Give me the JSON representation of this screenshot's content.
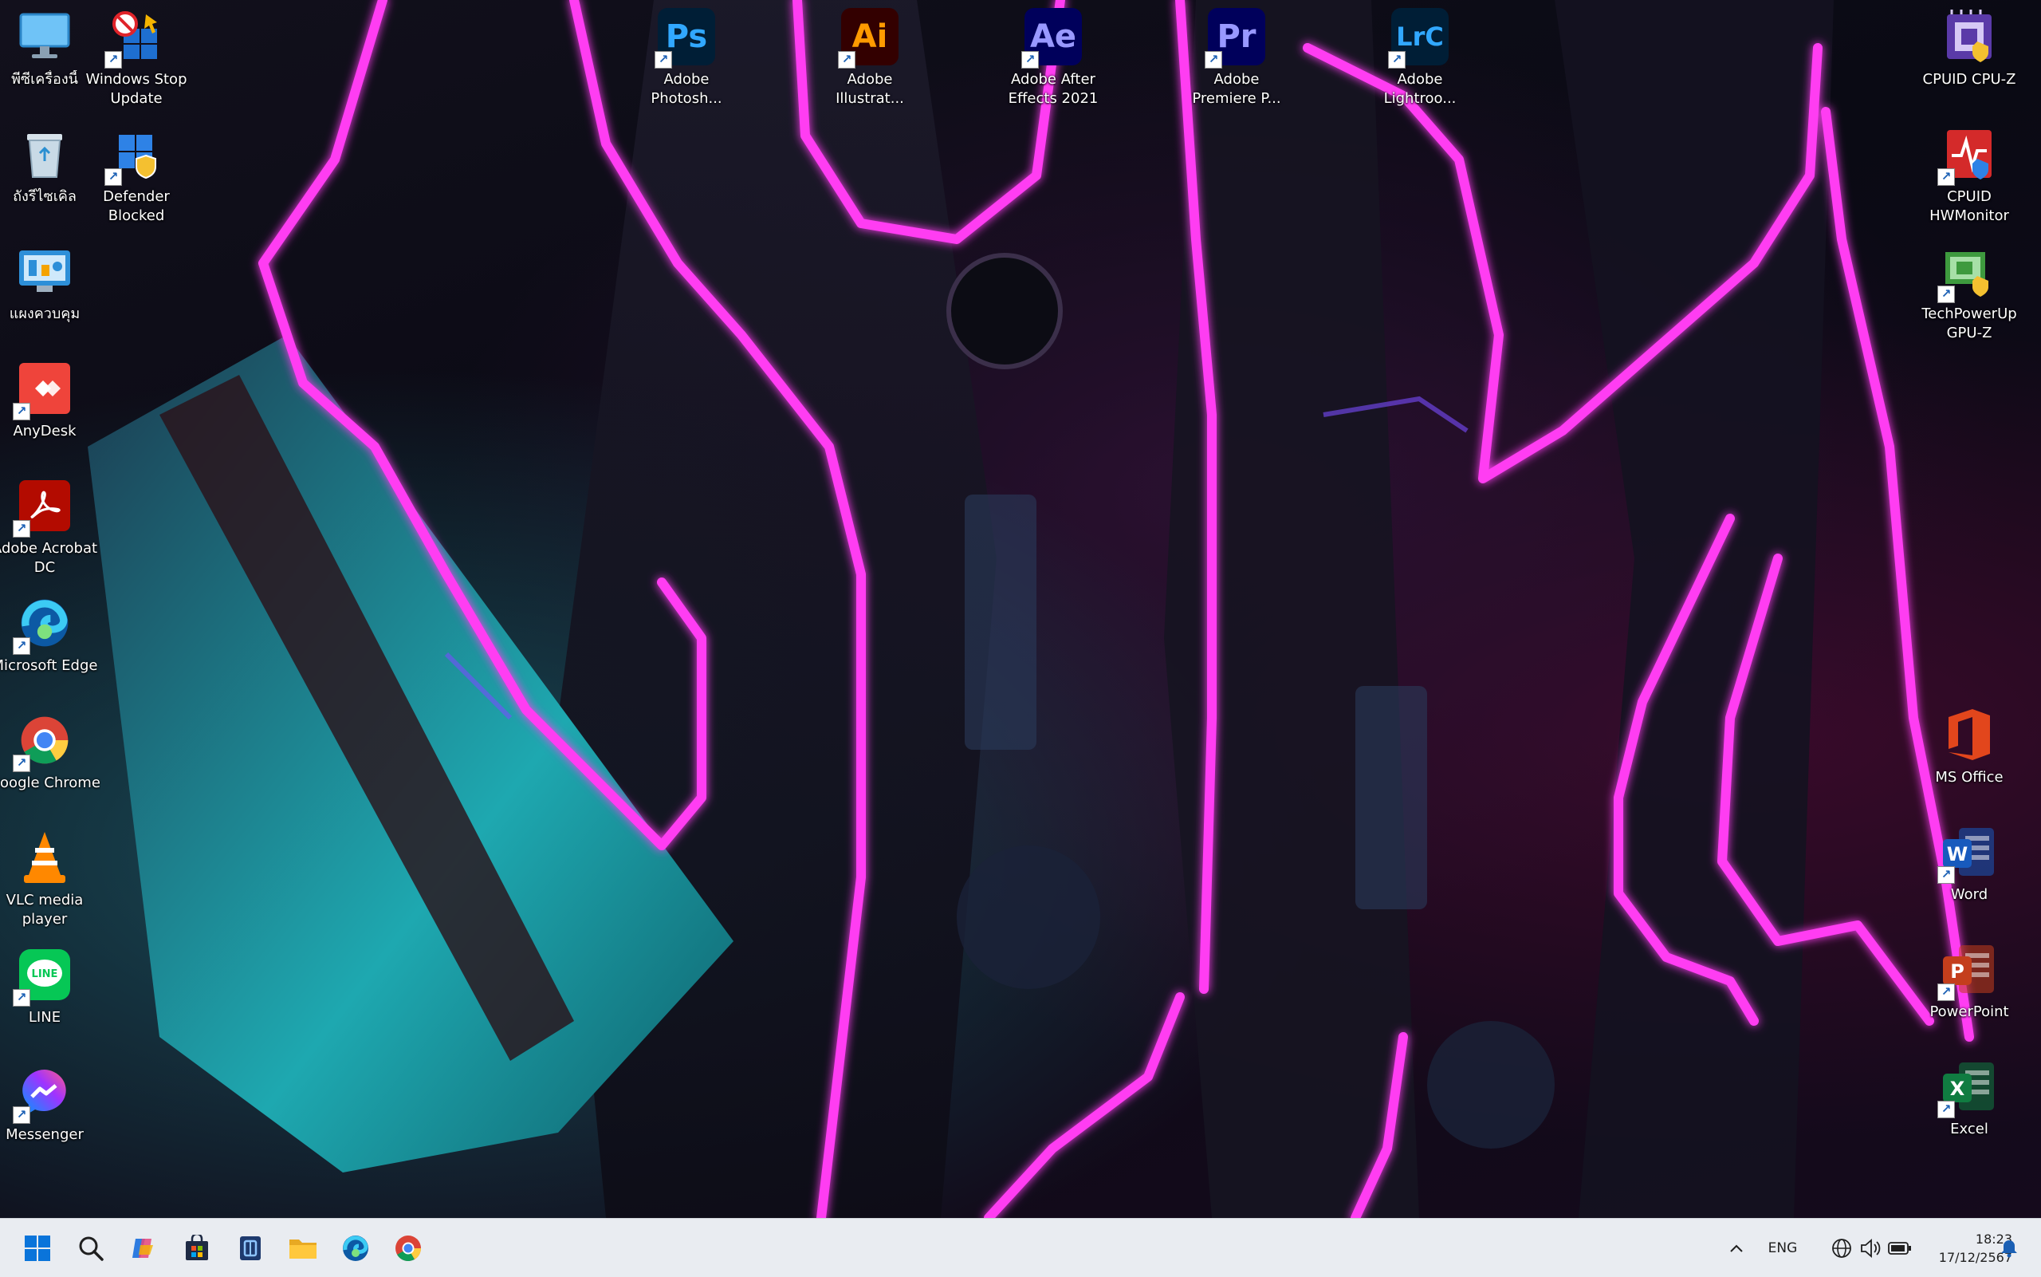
{
  "desktop": {
    "left_icons": [
      {
        "label": "พีซีเครื่องนี้",
        "icon": "monitor-icon",
        "color": "#3fa9f5",
        "shortcut": false
      },
      {
        "label": "ถังรีไซเคิล",
        "icon": "recycle-bin-icon",
        "color": "#9fb7c8",
        "shortcut": false
      },
      {
        "label": "แผงควบคุม",
        "icon": "control-panel-icon",
        "color": "#2d8fd8",
        "shortcut": false
      },
      {
        "label": "AnyDesk",
        "icon": "anydesk-icon",
        "color": "#ef443b",
        "shortcut": true
      },
      {
        "label": "Adobe Acrobat DC",
        "icon": "acrobat-icon",
        "color": "#b30b00",
        "shortcut": true
      },
      {
        "label": "Microsoft Edge",
        "icon": "edge-icon",
        "color": "#1f9cdc",
        "shortcut": true
      },
      {
        "label": "Google Chrome",
        "icon": "chrome-icon",
        "color": "#ffffff",
        "shortcut": true
      },
      {
        "label": "VLC media player",
        "icon": "vlc-icon",
        "color": "#ff8800",
        "shortcut": false
      },
      {
        "label": "LINE",
        "icon": "line-icon",
        "color": "#06c755",
        "shortcut": true
      },
      {
        "label": "Messenger",
        "icon": "messenger-icon",
        "color": "#a033ff",
        "shortcut": true
      }
    ],
    "second_column_icons": [
      {
        "label": "Windows Stop Update",
        "icon": "windows-stop-update-icon",
        "color": "#1e6fd0",
        "shortcut": true
      },
      {
        "label": "Defender Blocked",
        "icon": "defender-icon",
        "color": "#1e6fd0",
        "shortcut": true
      }
    ],
    "top_icons": [
      {
        "label": "Adobe Photosh...",
        "glyph": "Ps",
        "icon": "photoshop-icon",
        "bg": "#001e36",
        "fg": "#31a8ff"
      },
      {
        "label": "Adobe Illustrat...",
        "glyph": "Ai",
        "icon": "illustrator-icon",
        "bg": "#330000",
        "fg": "#ff9a00"
      },
      {
        "label": "Adobe After Effects 2021",
        "glyph": "Ae",
        "icon": "after-effects-icon",
        "bg": "#00005b",
        "fg": "#9999ff"
      },
      {
        "label": "Adobe Premiere P...",
        "glyph": "Pr",
        "icon": "premiere-icon",
        "bg": "#00005b",
        "fg": "#9999ff"
      },
      {
        "label": "Adobe Lightroo...",
        "glyph": "LrC",
        "icon": "lightroom-icon",
        "bg": "#001e36",
        "fg": "#31a8ff"
      }
    ],
    "right_icons": [
      {
        "label": "CPUID CPU-Z",
        "icon": "cpuz-icon",
        "color": "#6a3fb5",
        "shortcut": false
      },
      {
        "label": "CPUID HWMonitor",
        "icon": "hwmonitor-icon",
        "color": "#d42a2a",
        "shortcut": true
      },
      {
        "label": "TechPowerUp GPU-Z",
        "icon": "gpuz-icon",
        "color": "#3e9a3e",
        "shortcut": true
      }
    ],
    "office_icons": [
      {
        "label": "MS Office",
        "icon": "ms-office-icon",
        "color": "#e2461c",
        "glyph": "",
        "shortcut": false
      },
      {
        "label": "Word",
        "icon": "word-icon",
        "color": "#185abd",
        "glyph": "W",
        "shortcut": true
      },
      {
        "label": "PowerPoint",
        "icon": "powerpoint-icon",
        "color": "#c43e1c",
        "glyph": "P",
        "shortcut": true
      },
      {
        "label": "Excel",
        "icon": "excel-icon",
        "color": "#107c41",
        "glyph": "X",
        "shortcut": true
      }
    ]
  },
  "taskbar": {
    "pinned": [
      {
        "name": "start-button",
        "icon": "windows-logo-icon"
      },
      {
        "name": "search-button",
        "icon": "search-icon"
      },
      {
        "name": "copilot-button",
        "icon": "copilot-icon"
      },
      {
        "name": "ms-store-button",
        "icon": "store-icon"
      },
      {
        "name": "app-button",
        "icon": "book-icon"
      },
      {
        "name": "file-explorer-button",
        "icon": "folder-icon"
      },
      {
        "name": "edge-button",
        "icon": "edge-icon"
      },
      {
        "name": "chrome-button",
        "icon": "chrome-icon"
      }
    ],
    "tray": {
      "language": "ENG",
      "time": "18:23",
      "date": "17/12/2567"
    }
  }
}
